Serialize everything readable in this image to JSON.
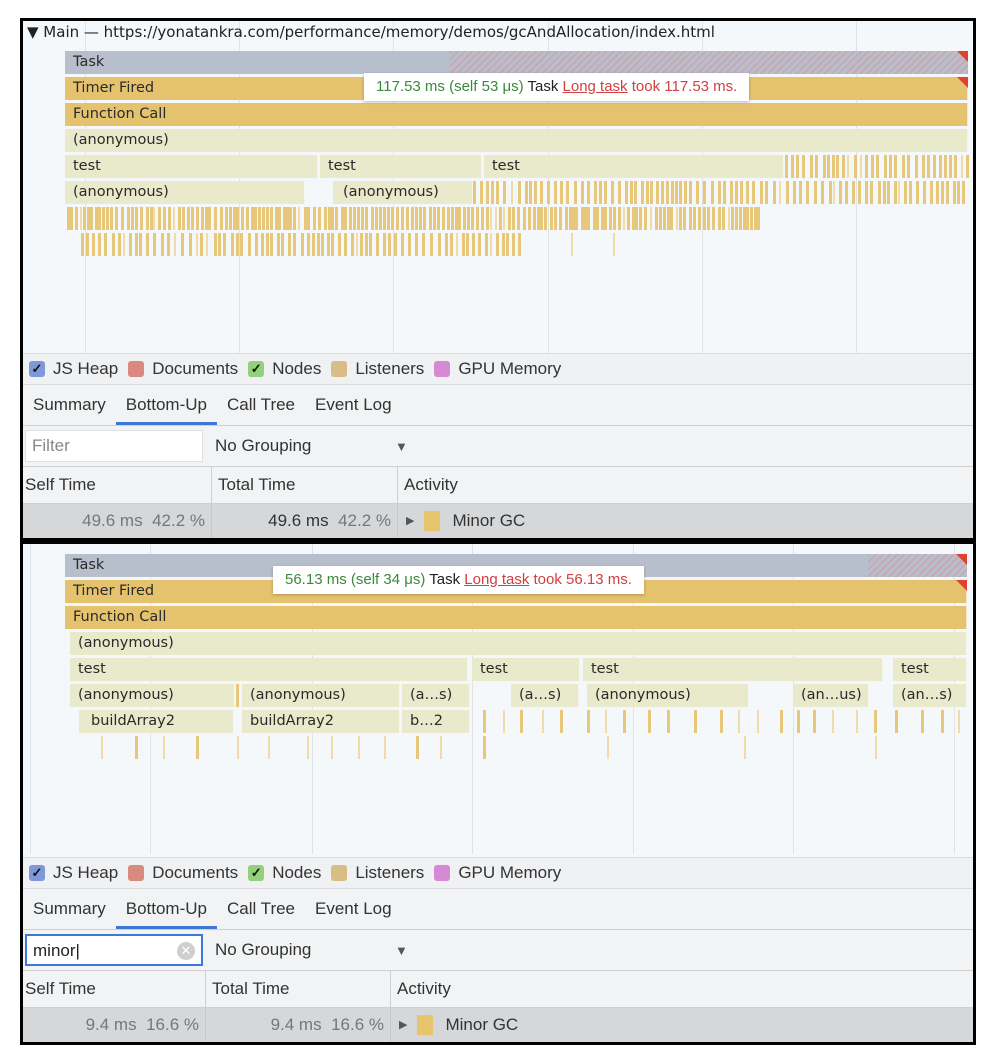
{
  "panel1": {
    "track_title": "▼ Main — https://yonatankra.com/performance/memory/demos/gcAndAllocation/index.html",
    "flame": {
      "task": "Task",
      "timer": "Timer Fired",
      "func": "Function Call",
      "anon": "(anonymous)",
      "tests": [
        "test",
        "test",
        "test"
      ],
      "anons": [
        "(anonymous)",
        "(anonymous)"
      ]
    },
    "tooltip": {
      "duration": "117.53 ms (self 53 μs)",
      "kind": "Task",
      "link": "Long task",
      "warning": "took 117.53 ms."
    },
    "legend": [
      {
        "label": "JS Heap",
        "color": "#7f98d9",
        "checked": true
      },
      {
        "label": "Documents",
        "color": "#d98a80",
        "checked": false
      },
      {
        "label": "Nodes",
        "color": "#94cf7c",
        "checked": true
      },
      {
        "label": "Listeners",
        "color": "#d8bd86",
        "checked": false
      },
      {
        "label": "GPU Memory",
        "color": "#d68ad6",
        "checked": false
      }
    ],
    "tabs": [
      "Summary",
      "Bottom-Up",
      "Call Tree",
      "Event Log"
    ],
    "active_tab": "Bottom-Up",
    "filter": {
      "value": "",
      "placeholder": "Filter"
    },
    "grouping": "No Grouping",
    "columns": [
      "Self Time",
      "Total Time",
      "Activity"
    ],
    "rows": [
      {
        "self_ms": "49.6 ms",
        "self_pct": "42.2 %",
        "total_ms": "49.6 ms",
        "total_pct": "42.2 %",
        "activity": "Minor GC",
        "color": "#e8c46e"
      }
    ]
  },
  "panel2": {
    "flame": {
      "task": "Task",
      "timer": "Timer Fired",
      "func": "Function Call",
      "anon": "(anonymous)",
      "tests": [
        "test",
        "test",
        "test",
        "test"
      ],
      "anons": [
        "(anonymous)",
        "(anonymous)",
        "(a…s)",
        "(a…s)",
        "(anonymous)",
        "(an…us)",
        "(an…s)"
      ],
      "builds": [
        "buildArray2",
        "buildArray2",
        "b…2"
      ]
    },
    "tooltip": {
      "duration": "56.13 ms (self 34 μs)",
      "kind": "Task",
      "link": "Long task",
      "warning": "took 56.13 ms."
    },
    "legend": [
      {
        "label": "JS Heap",
        "color": "#7f98d9",
        "checked": true
      },
      {
        "label": "Documents",
        "color": "#d98a80",
        "checked": false
      },
      {
        "label": "Nodes",
        "color": "#94cf7c",
        "checked": true
      },
      {
        "label": "Listeners",
        "color": "#d8bd86",
        "checked": false
      },
      {
        "label": "GPU Memory",
        "color": "#d68ad6",
        "checked": false
      }
    ],
    "tabs": [
      "Summary",
      "Bottom-Up",
      "Call Tree",
      "Event Log"
    ],
    "active_tab": "Bottom-Up",
    "filter": {
      "value": "minor",
      "placeholder": "Filter"
    },
    "grouping": "No Grouping",
    "columns": [
      "Self Time",
      "Total Time",
      "Activity"
    ],
    "rows": [
      {
        "self_ms": "9.4 ms",
        "self_pct": "16.6 %",
        "total_ms": "9.4 ms",
        "total_pct": "16.6 %",
        "activity": "Minor GC",
        "color": "#e8c46e"
      }
    ]
  }
}
